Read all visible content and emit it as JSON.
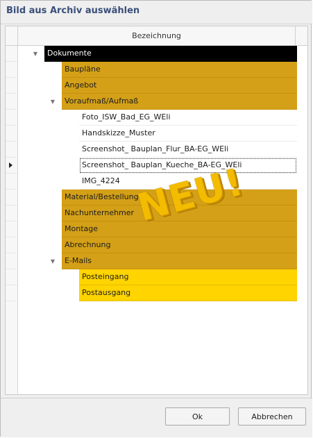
{
  "dialog": {
    "title": "Bild aus Archiv auswählen"
  },
  "grid": {
    "column_header": "Bezeichnung",
    "rows": [
      {
        "label": "Dokumente",
        "level": 0,
        "expanded": true,
        "color": "#000000"
      },
      {
        "label": "Baupläne",
        "level": 1,
        "color": "#d4a017"
      },
      {
        "label": "Angebot",
        "level": 1,
        "color": "#d4a017"
      },
      {
        "label": "Voraufmaß/Aufmaß",
        "level": 1,
        "expanded": true,
        "color": "#d4a017"
      },
      {
        "label": "Foto_ISW_Bad_EG_WEli",
        "level": 2,
        "color": "#ffffff"
      },
      {
        "label": "Handskizze_Muster",
        "level": 2,
        "color": "#ffffff"
      },
      {
        "label": "Screenshot_ Bauplan_Flur_BA-EG_WEli",
        "level": 2,
        "color": "#ffffff"
      },
      {
        "label": "Screenshot_ Bauplan_Kueche_BA-EG_WEli",
        "level": 2,
        "color": "#ffffff",
        "selected": true
      },
      {
        "label": "IMG_4224",
        "level": 2,
        "color": "#ffffff"
      },
      {
        "label": "Material/Bestellungen",
        "level": 1,
        "color": "#d4a017"
      },
      {
        "label": "Nachunternehmer",
        "level": 1,
        "color": "#d4a017"
      },
      {
        "label": "Montage",
        "level": 1,
        "color": "#d4a017"
      },
      {
        "label": "Abrechnung",
        "level": 1,
        "color": "#d4a017"
      },
      {
        "label": "E-Mails",
        "level": 1,
        "expanded": true,
        "color": "#d4a017"
      },
      {
        "label": "Posteingang",
        "level": 2,
        "color": "#ffd400"
      },
      {
        "label": "Postausgang",
        "level": 2,
        "color": "#ffd400"
      }
    ]
  },
  "stamp": {
    "text": "NEU!"
  },
  "footer": {
    "ok_label": "Ok",
    "cancel_label": "Abbrechen"
  }
}
